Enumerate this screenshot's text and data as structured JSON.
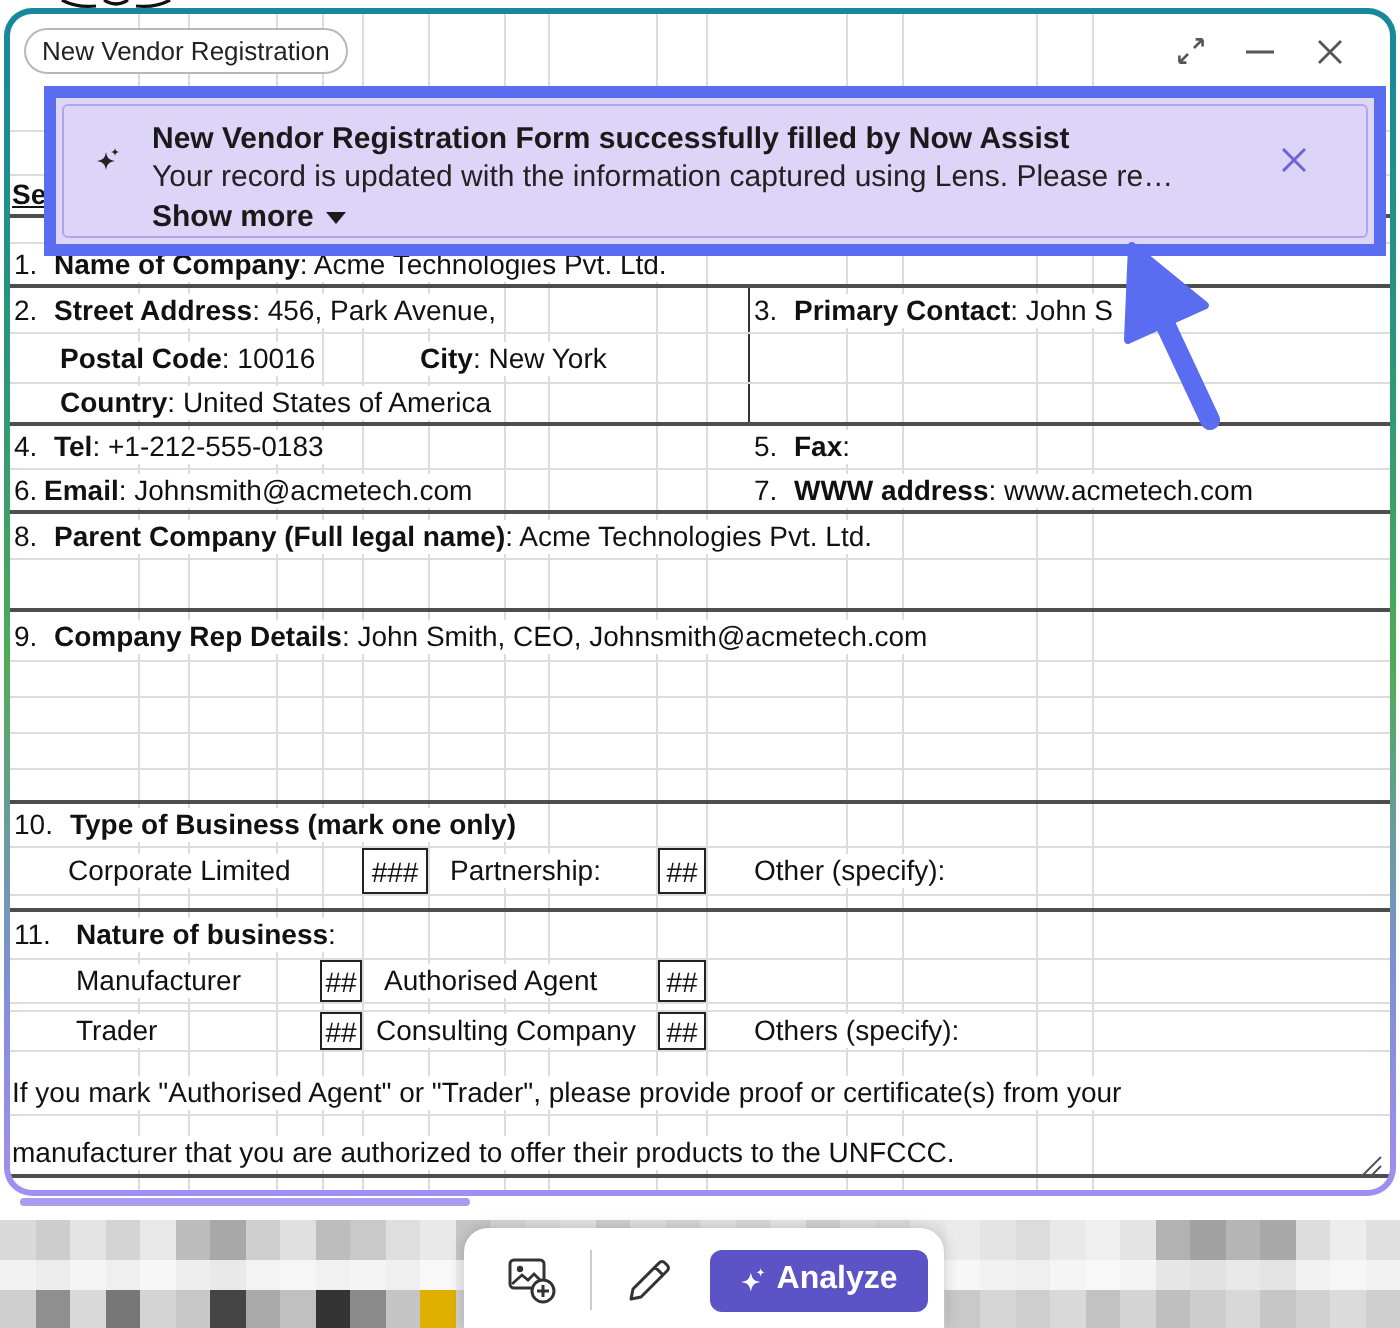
{
  "window": {
    "title": "New Vendor Registration"
  },
  "notification": {
    "title": "New Vendor Registration Form successfully filled by Now Assist",
    "message": "Your record is updated with the information captured using Lens. Please re…",
    "toggle": {
      "label": "Show more",
      "expanded": false
    }
  },
  "form": {
    "section_heading": "Se",
    "fields": [
      {
        "number": "1.",
        "text": "**Name of Company**: Acme Technologies Pvt. Ltd."
      },
      {
        "number": "2.",
        "text": "**Street Address**: 456, Park Avenue,",
        "details": [
          "**Postal Code**: 10016",
          "**City**: New York",
          "**Country**: United States of America"
        ]
      },
      {
        "number": "3.",
        "text": "**Primary Contact**: John S"
      },
      {
        "number": "4.",
        "text": "**Tel**: +1-212-555-0183"
      },
      {
        "number": "5.",
        "text": "**Fax**:"
      },
      {
        "number": "6.",
        "text": "**Email**: Johnsmith@acmetech.com"
      },
      {
        "number": "7.",
        "text": "**WWW address**: www.acmetech.com"
      },
      {
        "number": "8.",
        "text": "**Parent Company (Full legal name)**: Acme Technologies Pvt. Ltd."
      },
      {
        "number": "9.",
        "text": "**Company Rep Details**: John Smith, CEO, Johnsmith@acmetech.com"
      }
    ],
    "type_of_business": {
      "number": "10.",
      "title": "Type of Business (mark one only)",
      "options": [
        {
          "label": "Corporate Limited",
          "value": "###"
        },
        {
          "label": "Partnership:",
          "value": "##"
        },
        {
          "label": "Other (specify):"
        }
      ]
    },
    "nature_of_business": {
      "number": "11.",
      "title": "**Nature of business**:",
      "option_rows": [
        {
          "options": [
            {
              "label": "Manufacturer",
              "value": "##"
            },
            {
              "label": "Authorised Agent",
              "value": "##"
            }
          ]
        },
        {
          "options": [
            {
              "label": "Trader",
              "value": "##"
            },
            {
              "label": "Consulting Company",
              "value": "##"
            },
            {
              "label": "Others (specify):"
            }
          ]
        }
      ]
    },
    "note": [
      "If you mark \"Authorised Agent\" or \"Trader\", please provide proof or certificate(s) from your",
      "manufacturer that you are authorized to offer their products to the UNFCCC."
    ]
  },
  "toolbar": {
    "action_button": "Analyze"
  }
}
